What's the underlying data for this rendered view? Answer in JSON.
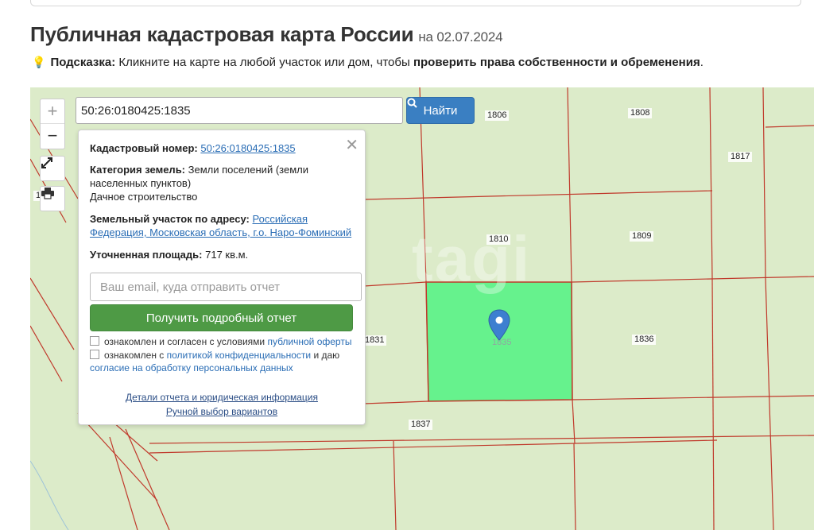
{
  "header": {
    "title": "Публичная кадастровая карта России",
    "date": "на 02.07.2024"
  },
  "hint": {
    "icon": "lightbulb-icon",
    "label": "Подсказка:",
    "text": "Кликните на карте на любой участок или дом, чтобы",
    "emphasis": "проверить права собственности и обременения",
    "end": "."
  },
  "search": {
    "value": "50:26:0180425:1835",
    "button_label": "Найти"
  },
  "map_controls": {
    "zoom_in": "+",
    "zoom_out": "−"
  },
  "popup": {
    "cadastral_label": "Кадастровый номер:",
    "cadastral_value": "50:26:0180425:1835",
    "category_label": "Категория земель:",
    "category_value": "Земли поселений (земли населенных пунктов)",
    "category_use": "Дачное строительство",
    "address_label": "Земельный участок по адресу:",
    "address_value": "Российская Федерация, Московская область, г.о. Наро-Фоминский",
    "area_label": "Уточненная площадь:",
    "area_value": "717 кв.м.",
    "email_placeholder": "Ваш email, куда отправить отчет",
    "report_button": "Получить подробный отчет",
    "consent1_text": "ознакомлен и согласен с условиями",
    "consent1_link": "публичной оферты",
    "consent2_text": "ознакомлен с",
    "consent2_link": "политикой конфиденциальности",
    "consent2_mid": "и даю",
    "consent2_link2": "согласие на обработку персональных данных",
    "details_link": "Детали отчета и юридическая информация",
    "manual_link": "Ручной выбор вариантов"
  },
  "parcels": {
    "p1806": "1806",
    "p1808": "1808",
    "p1817": "1817",
    "p1810": "1810",
    "p1809": "1809",
    "p1831": "1831",
    "p1835": "1835",
    "p1836": "1836",
    "p1837": "1837",
    "p1": "1"
  },
  "watermark": "tagi",
  "colors": {
    "parcel_line": "#c0392b",
    "selected_parcel": "#66f28d",
    "map_bg": "#dcebc9",
    "pin": "#3d7fd0",
    "search_button": "#3a7fc2",
    "report_button": "#4e9a45"
  }
}
